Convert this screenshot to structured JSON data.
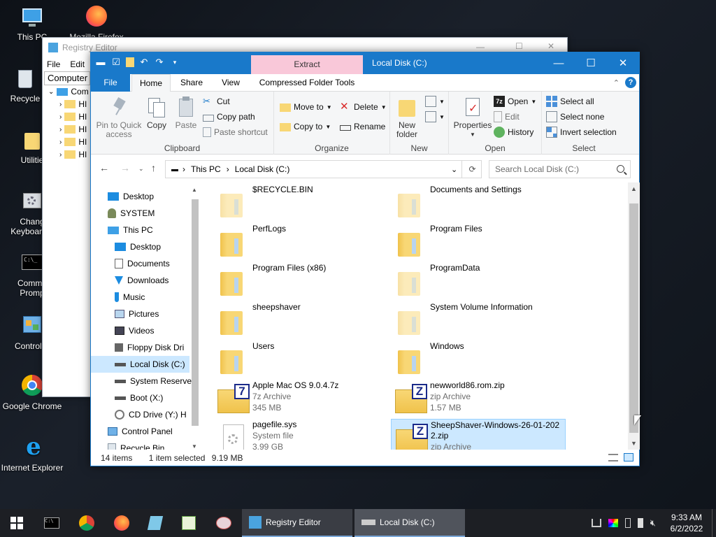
{
  "desktop": {
    "icons": [
      {
        "label": "This PC",
        "icon": "this-pc-icon"
      },
      {
        "label": "Mozilla Firefox",
        "icon": "firefox-icon"
      },
      {
        "label": "Recycle",
        "icon": "recycle-bin-icon"
      },
      {
        "label": "Utilitie",
        "icon": "folder-icon"
      },
      {
        "label": "Chang",
        "label2": "Keyboard L",
        "icon": "keyboard-settings-icon"
      },
      {
        "label": "Comma",
        "label2": "Promp",
        "icon": "command-prompt-icon"
      },
      {
        "label": "Control P",
        "icon": "control-panel-icon"
      },
      {
        "label": "Google Chrome",
        "icon": "chrome-icon"
      },
      {
        "label": "Internet Explorer",
        "icon": "ie-icon"
      }
    ]
  },
  "registry": {
    "title": "Registry Editor",
    "menu": [
      "File",
      "Edit"
    ],
    "address": "Computer",
    "tree_root": "Com",
    "tree_items": [
      "HI",
      "HI",
      "HI",
      "HI",
      "HI"
    ]
  },
  "explorer": {
    "title": "Local Disk (C:)",
    "context_tab": "Extract",
    "tabs": {
      "file": "File",
      "home": "Home",
      "share": "Share",
      "view": "View",
      "compressed": "Compressed Folder Tools"
    },
    "ribbon": {
      "clipboard": {
        "label": "Clipboard",
        "pin": "Pin to Quick",
        "pin2": "access",
        "copy": "Copy",
        "paste": "Paste",
        "cut": "Cut",
        "copy_path": "Copy path",
        "paste_shortcut": "Paste shortcut"
      },
      "organize": {
        "label": "Organize",
        "move_to": "Move to",
        "copy_to": "Copy to",
        "delete": "Delete",
        "rename": "Rename"
      },
      "new": {
        "label": "New",
        "new_folder": "New",
        "new_folder2": "folder"
      },
      "open": {
        "label": "Open",
        "properties": "Properties",
        "open": "Open",
        "edit": "Edit",
        "history": "History"
      },
      "select": {
        "label": "Select",
        "select_all": "Select all",
        "select_none": "Select none",
        "invert": "Invert selection"
      }
    },
    "address": {
      "crumb1": "This PC",
      "crumb2": "Local Disk (C:)"
    },
    "search_placeholder": "Search Local Disk (C:)",
    "nav": [
      {
        "label": "Desktop",
        "icon": "desktop-icon",
        "indent": 0
      },
      {
        "label": "SYSTEM",
        "icon": "user-icon",
        "indent": 0
      },
      {
        "label": "This PC",
        "icon": "this-pc-icon",
        "indent": 0
      },
      {
        "label": "Desktop",
        "icon": "desktop-icon",
        "indent": 1
      },
      {
        "label": "Documents",
        "icon": "documents-icon",
        "indent": 1
      },
      {
        "label": "Downloads",
        "icon": "downloads-icon",
        "indent": 1
      },
      {
        "label": "Music",
        "icon": "music-icon",
        "indent": 1
      },
      {
        "label": "Pictures",
        "icon": "pictures-icon",
        "indent": 1
      },
      {
        "label": "Videos",
        "icon": "videos-icon",
        "indent": 1
      },
      {
        "label": "Floppy Disk Dri",
        "icon": "floppy-icon",
        "indent": 1
      },
      {
        "label": "Local Disk (C:)",
        "icon": "drive-icon",
        "indent": 1,
        "selected": true
      },
      {
        "label": "System Reserve",
        "icon": "drive-icon",
        "indent": 1
      },
      {
        "label": "Boot (X:)",
        "icon": "drive-icon",
        "indent": 1
      },
      {
        "label": "CD Drive (Y:) H",
        "icon": "cd-drive-icon",
        "indent": 1
      },
      {
        "label": "Control Panel",
        "icon": "control-panel-icon",
        "indent": 0
      },
      {
        "label": "Recycle Bin",
        "icon": "recycle-bin-icon",
        "indent": 0
      }
    ],
    "files": [
      {
        "name": "$RECYCLE.BIN",
        "kind": "folder-faded"
      },
      {
        "name": "Documents and Settings",
        "kind": "folder-faded"
      },
      {
        "name": "PerfLogs",
        "kind": "folder"
      },
      {
        "name": "Program Files",
        "kind": "folder"
      },
      {
        "name": "Program Files (x86)",
        "kind": "folder"
      },
      {
        "name": "ProgramData",
        "kind": "folder-faded"
      },
      {
        "name": "sheepshaver",
        "kind": "folder"
      },
      {
        "name": "System Volume Information",
        "kind": "folder-faded"
      },
      {
        "name": "Users",
        "kind": "folder"
      },
      {
        "name": "Windows",
        "kind": "folder"
      },
      {
        "name": "Apple Mac OS 9.0.4.7z",
        "type": "7z Archive",
        "size": "345 MB",
        "kind": "7z"
      },
      {
        "name": "newworld86.rom.zip",
        "type": "zip Archive",
        "size": "1.57 MB",
        "kind": "zip"
      },
      {
        "name": "pagefile.sys",
        "type": "System file",
        "size": "3.99 GB",
        "kind": "sys"
      },
      {
        "name": "SheepShaver-Windows-26-01-2022.zip",
        "type": "zip Archive",
        "size": "",
        "kind": "zip",
        "selected": true
      }
    ],
    "status": {
      "count": "14 items",
      "selected": "1 item selected",
      "size": "9.19 MB"
    }
  },
  "taskbar": {
    "tasks": [
      {
        "label": "Registry Editor"
      },
      {
        "label": "Local Disk (C:)"
      }
    ],
    "time": "9:33 AM",
    "date": "6/2/2022"
  },
  "colors": {
    "accent": "#1979ca",
    "context_tab": "#f9c8d9",
    "selection": "#cce8ff"
  }
}
